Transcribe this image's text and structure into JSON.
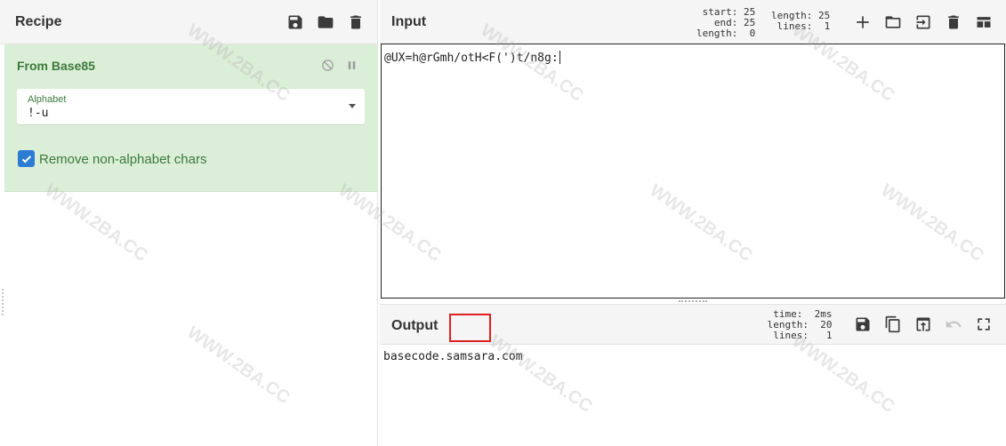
{
  "recipe": {
    "title": "Recipe",
    "icons": [
      "save-icon",
      "folder-icon",
      "trash-icon"
    ],
    "operation": {
      "name": "From Base85",
      "alphabet_label": "Alphabet",
      "alphabet_value": "!-u",
      "remove_non_alphabet_label": "Remove non-alphabet chars",
      "remove_non_alphabet_checked": true
    }
  },
  "input": {
    "title": "Input",
    "stats_left": "start: 25\n  end: 25\nlength:  0",
    "stats_right": "length: 25\n lines:  1",
    "text": "@UX=h@rGmh/otH<F(')t/n8g:",
    "icons": [
      "plus-icon",
      "folder-icon",
      "import-icon",
      "trash-icon",
      "layout-icon"
    ]
  },
  "output": {
    "title": "Output",
    "stats": "  time:  2ms\nlength:  20\n lines:   1",
    "text": "basecode.samsara.com",
    "icons": [
      "save-icon",
      "copy-icon",
      "replace-input-icon",
      "undo-icon",
      "maximize-icon"
    ]
  },
  "watermark": "WWW.2BA.CC",
  "colors": {
    "operation_bg": "#dbeed7",
    "operation_text": "#3c7a3c",
    "checkbox": "#2b7cd3",
    "highlight": "#e02020"
  }
}
